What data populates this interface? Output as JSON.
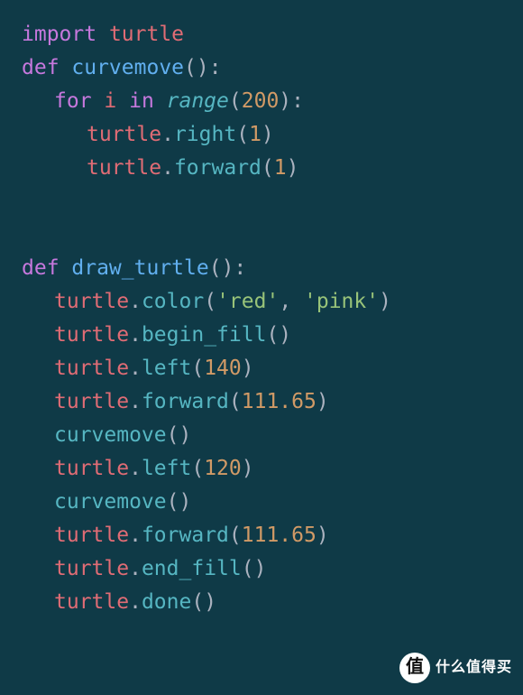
{
  "colors": {
    "background": "#0f3a47",
    "keyword": "#c678dd",
    "definition": "#61afef",
    "identifier": "#e06c75",
    "member": "#e5c07b",
    "function": "#56b6c2",
    "number": "#d19a66",
    "string": "#98c379",
    "punct": "#abb2bf"
  },
  "code": {
    "lines": [
      {
        "indent": 0,
        "tokens": [
          {
            "t": "import ",
            "c": "keyword"
          },
          {
            "t": "turtle",
            "c": "ident"
          }
        ]
      },
      {
        "indent": 0,
        "tokens": [
          {
            "t": "def ",
            "c": "keyword"
          },
          {
            "t": "curvemove",
            "c": "def"
          },
          {
            "t": "():",
            "c": "punct"
          }
        ]
      },
      {
        "indent": 1,
        "tokens": [
          {
            "t": "for ",
            "c": "keyword"
          },
          {
            "t": "i",
            "c": "ident"
          },
          {
            "t": " in ",
            "c": "keyword"
          },
          {
            "t": "range",
            "c": "funcital"
          },
          {
            "t": "(",
            "c": "punct"
          },
          {
            "t": "200",
            "c": "num"
          },
          {
            "t": "):",
            "c": "punct"
          }
        ]
      },
      {
        "indent": 2,
        "tokens": [
          {
            "t": "turtle",
            "c": "ident"
          },
          {
            "t": ".",
            "c": "punct"
          },
          {
            "t": "right",
            "c": "func"
          },
          {
            "t": "(",
            "c": "punct"
          },
          {
            "t": "1",
            "c": "num"
          },
          {
            "t": ")",
            "c": "punct"
          }
        ]
      },
      {
        "indent": 2,
        "tokens": [
          {
            "t": "turtle",
            "c": "ident"
          },
          {
            "t": ".",
            "c": "punct"
          },
          {
            "t": "forward",
            "c": "func"
          },
          {
            "t": "(",
            "c": "punct"
          },
          {
            "t": "1",
            "c": "num"
          },
          {
            "t": ")",
            "c": "punct"
          }
        ]
      },
      {
        "indent": 0,
        "tokens": []
      },
      {
        "indent": 0,
        "tokens": []
      },
      {
        "indent": 0,
        "tokens": [
          {
            "t": "def ",
            "c": "keyword"
          },
          {
            "t": "draw_turtle",
            "c": "def"
          },
          {
            "t": "():",
            "c": "punct"
          }
        ]
      },
      {
        "indent": 1,
        "tokens": [
          {
            "t": "turtle",
            "c": "ident"
          },
          {
            "t": ".",
            "c": "punct"
          },
          {
            "t": "color",
            "c": "func"
          },
          {
            "t": "(",
            "c": "punct"
          },
          {
            "t": "'red'",
            "c": "str"
          },
          {
            "t": ", ",
            "c": "punct"
          },
          {
            "t": "'pink'",
            "c": "str"
          },
          {
            "t": ")",
            "c": "punct"
          }
        ]
      },
      {
        "indent": 1,
        "tokens": [
          {
            "t": "turtle",
            "c": "ident"
          },
          {
            "t": ".",
            "c": "punct"
          },
          {
            "t": "begin_fill",
            "c": "func"
          },
          {
            "t": "()",
            "c": "punct"
          }
        ]
      },
      {
        "indent": 1,
        "tokens": [
          {
            "t": "turtle",
            "c": "ident"
          },
          {
            "t": ".",
            "c": "punct"
          },
          {
            "t": "left",
            "c": "func"
          },
          {
            "t": "(",
            "c": "punct"
          },
          {
            "t": "140",
            "c": "num"
          },
          {
            "t": ")",
            "c": "punct"
          }
        ]
      },
      {
        "indent": 1,
        "tokens": [
          {
            "t": "turtle",
            "c": "ident"
          },
          {
            "t": ".",
            "c": "punct"
          },
          {
            "t": "forward",
            "c": "func"
          },
          {
            "t": "(",
            "c": "punct"
          },
          {
            "t": "111.65",
            "c": "num"
          },
          {
            "t": ")",
            "c": "punct"
          }
        ]
      },
      {
        "indent": 1,
        "tokens": [
          {
            "t": "curvemove",
            "c": "func"
          },
          {
            "t": "()",
            "c": "punct"
          }
        ]
      },
      {
        "indent": 1,
        "tokens": [
          {
            "t": "turtle",
            "c": "ident"
          },
          {
            "t": ".",
            "c": "punct"
          },
          {
            "t": "left",
            "c": "func"
          },
          {
            "t": "(",
            "c": "punct"
          },
          {
            "t": "120",
            "c": "num"
          },
          {
            "t": ")",
            "c": "punct"
          }
        ]
      },
      {
        "indent": 1,
        "tokens": [
          {
            "t": "curvemove",
            "c": "func"
          },
          {
            "t": "()",
            "c": "punct"
          }
        ]
      },
      {
        "indent": 1,
        "tokens": [
          {
            "t": "turtle",
            "c": "ident"
          },
          {
            "t": ".",
            "c": "punct"
          },
          {
            "t": "forward",
            "c": "func"
          },
          {
            "t": "(",
            "c": "punct"
          },
          {
            "t": "111.65",
            "c": "num"
          },
          {
            "t": ")",
            "c": "punct"
          }
        ]
      },
      {
        "indent": 1,
        "tokens": [
          {
            "t": "turtle",
            "c": "ident"
          },
          {
            "t": ".",
            "c": "punct"
          },
          {
            "t": "end_fill",
            "c": "func"
          },
          {
            "t": "()",
            "c": "punct"
          }
        ]
      },
      {
        "indent": 1,
        "tokens": [
          {
            "t": "turtle",
            "c": "ident"
          },
          {
            "t": ".",
            "c": "punct"
          },
          {
            "t": "done",
            "c": "func"
          },
          {
            "t": "()",
            "c": "punct"
          }
        ]
      }
    ]
  },
  "watermark": {
    "badge": "值",
    "text": "什么值得买"
  }
}
